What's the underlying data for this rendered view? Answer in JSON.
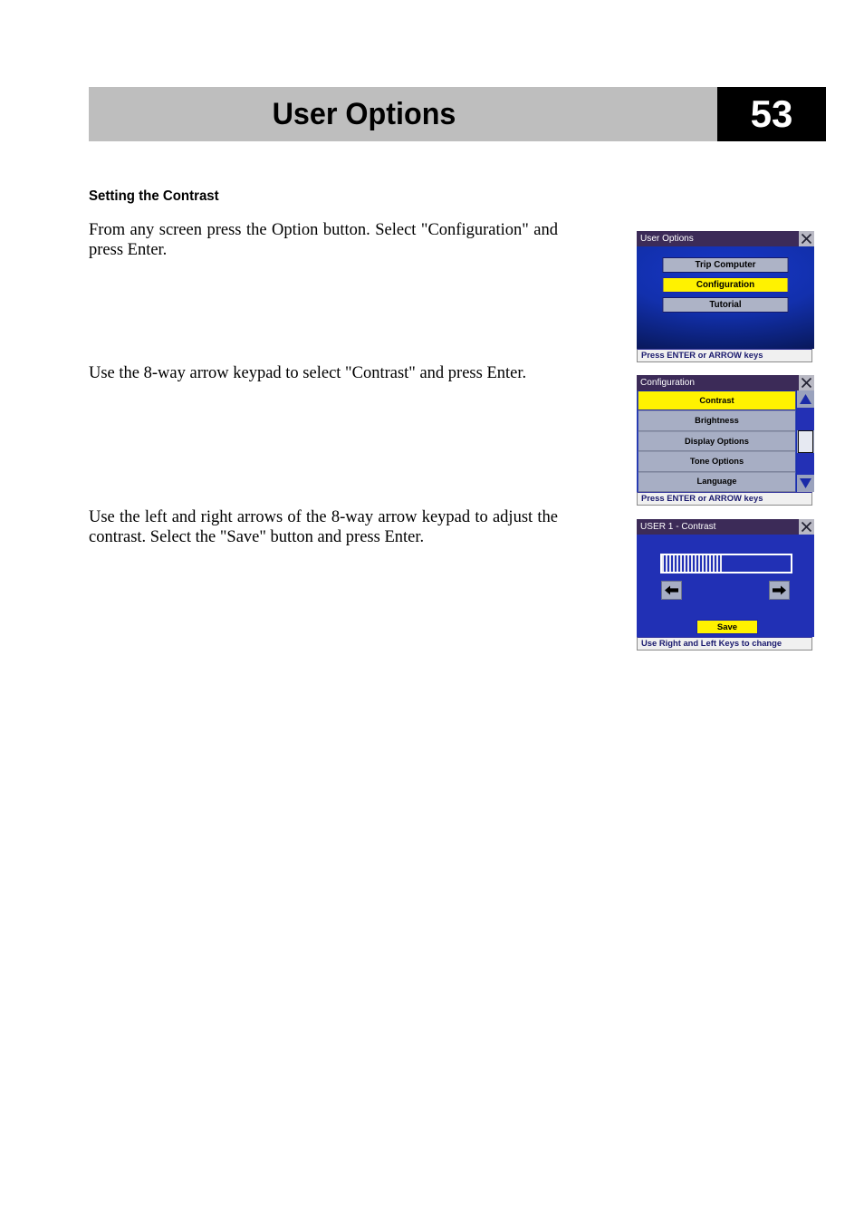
{
  "header": {
    "title": "User Options",
    "page_number": "53"
  },
  "content": {
    "section_heading": "Setting the Contrast",
    "paragraph_1": "From any screen press the Option button. Select \"Configuration\" and press Enter.",
    "paragraph_2": "Use the 8-way arrow keypad to select \"Contrast\" and press Enter.",
    "paragraph_3": "Use the left and right arrows of the 8-way arrow keypad to adjust the contrast. Select the \"Save\" button and press Enter."
  },
  "screens": {
    "user_options": {
      "title": "User Options",
      "close_icon": "close-icon",
      "buttons": [
        {
          "label": "Trip Computer",
          "selected": false
        },
        {
          "label": "Configuration",
          "selected": true
        },
        {
          "label": "Tutorial",
          "selected": false
        }
      ],
      "status": "Press ENTER or ARROW keys"
    },
    "configuration": {
      "title": "Configuration",
      "close_icon": "close-icon",
      "items": [
        {
          "label": "Contrast",
          "selected": true
        },
        {
          "label": "Brightness",
          "selected": false
        },
        {
          "label": "Display Options",
          "selected": false
        },
        {
          "label": "Tone Options",
          "selected": false
        },
        {
          "label": "Language",
          "selected": false
        }
      ],
      "scrollbar": {
        "up_icon": "triangle-up-icon",
        "down_icon": "triangle-down-icon",
        "thumb": "scrollbar-thumb"
      },
      "status": "Press ENTER or ARROW keys"
    },
    "contrast": {
      "title": "USER 1 - Contrast",
      "close_icon": "close-icon",
      "bar": {
        "segments_filled": 17,
        "segments_total": 24
      },
      "left_arrow_icon": "arrow-left-icon",
      "right_arrow_icon": "arrow-right-icon",
      "save_label": "Save",
      "status": "Use Right and Left Keys to change"
    }
  },
  "colors": {
    "header_band": "#bebebe",
    "page_box": "#000000",
    "titlebar": "#3c2b58",
    "screen_blue": "#2130b5",
    "button_gray": "#a7aec4",
    "highlight_yellow": "#fff200",
    "status_text": "#1a1a6e"
  }
}
